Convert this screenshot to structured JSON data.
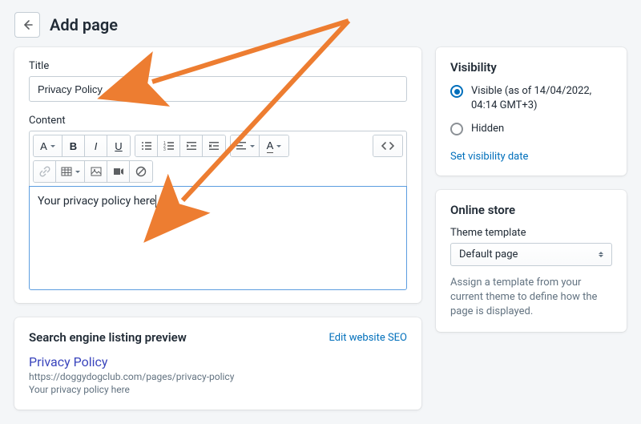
{
  "header": {
    "title": "Add page"
  },
  "main": {
    "title_label": "Title",
    "title_value": "Privacy Policy",
    "content_label": "Content",
    "editor_text": "Your privacy policy here"
  },
  "seo": {
    "heading": "Search engine listing preview",
    "edit_link": "Edit website SEO",
    "page_title": "Privacy Policy",
    "url": "https://doggydogclub.com/pages/privacy-policy",
    "description": "Your privacy policy here"
  },
  "visibility": {
    "heading": "Visibility",
    "visible_label": "Visible (as of 14/04/2022, 04:14 GMT+3)",
    "hidden_label": "Hidden",
    "set_date_link": "Set visibility date"
  },
  "online_store": {
    "heading": "Online store",
    "template_label": "Theme template",
    "select_value": "Default page",
    "help": "Assign a template from your current theme to define how the page is displayed."
  },
  "toolbar": {
    "format": "A",
    "bold": "B",
    "italic": "I",
    "underline": "U"
  }
}
